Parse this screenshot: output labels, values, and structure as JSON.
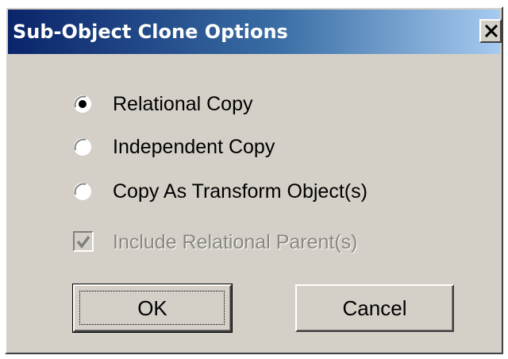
{
  "window": {
    "title": "Sub-Object Clone Options",
    "close_icon": "close-icon",
    "close_glyph": "X"
  },
  "options": {
    "relational_copy": {
      "label": "Relational Copy",
      "selected": true
    },
    "independent_copy": {
      "label": "Independent Copy",
      "selected": false
    },
    "copy_as_transform": {
      "label": "Copy As Transform Object(s)",
      "selected": false
    }
  },
  "include_parents": {
    "label": "Include Relational Parent(s)",
    "checked": true,
    "enabled": false
  },
  "buttons": {
    "ok_label": "OK",
    "cancel_label": "Cancel"
  },
  "colors": {
    "dialog_face": "#d4d0c8",
    "title_start": "#0a246a",
    "title_end": "#a6caf0",
    "disabled_text": "#8a8780"
  }
}
